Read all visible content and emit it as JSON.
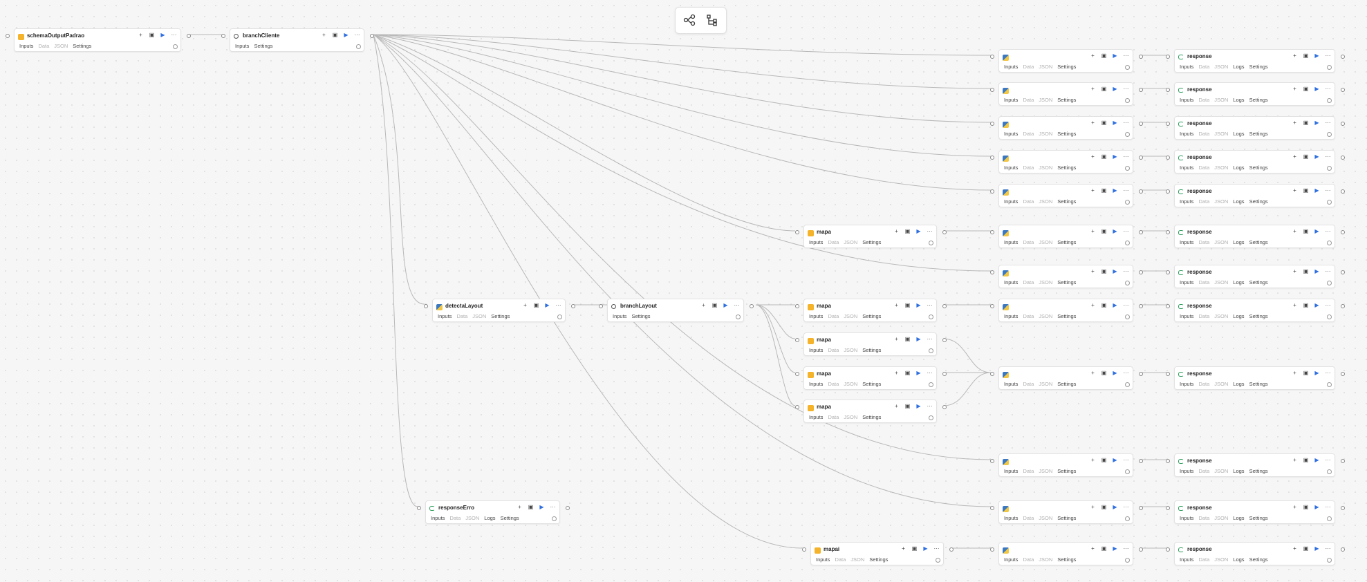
{
  "toolbar": {
    "left_icon": "workflow-graph-icon",
    "right_icon": "tree-layout-icon"
  },
  "colors": {
    "play": "#2f6fe0",
    "map_icon": "#f4b32b",
    "response_icon": "#2a9d5a",
    "edge": "#b8b8b8"
  },
  "tabs": {
    "inputs": "Inputs",
    "data": "Data",
    "json": "JSON",
    "logs": "Logs",
    "settings": "Settings"
  },
  "nodes": {
    "schema": {
      "title": "schemaOutputPadrao"
    },
    "branch_cliente": {
      "title": "branchCliente"
    },
    "detecta": {
      "title": "detectaLayout"
    },
    "branch_layout": {
      "title": "branchLayout"
    },
    "response_erro": {
      "title": "responseErro"
    },
    "mapa": {
      "title": "mapa"
    },
    "mapai": {
      "title": "mapai"
    },
    "response": {
      "title": "response"
    }
  }
}
